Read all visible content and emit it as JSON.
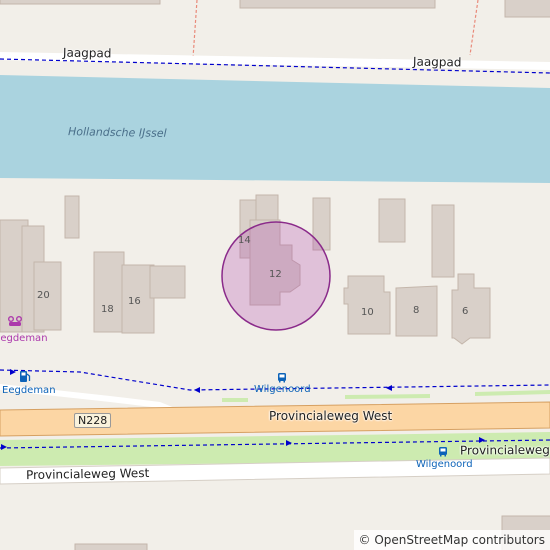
{
  "map": {
    "streets": {
      "jaagpad_left": "Jaagpad",
      "jaagpad_right": "Jaagpad",
      "provincialeweg_main": "Provincialeweg West",
      "provincialeweg_right": "Provincialeweg West",
      "provincialeweg_bottom": "Provincialeweg West",
      "road_ref": "N228"
    },
    "water": {
      "name": "Hollandsche IJssel"
    },
    "house_numbers": [
      "14",
      "12",
      "20",
      "16",
      "18",
      "10",
      "8",
      "6"
    ],
    "pois": {
      "eegdeman_top": "Eegdeman",
      "eegdeman_fuel": "Eegdeman",
      "wilgenoord_top": "Wilgenoord",
      "wilgenoord_bottom": "Wilgenoord"
    },
    "icons": {
      "car_repair": "car-repair-icon",
      "fuel": "fuel-icon",
      "bus_stop": "bus-stop-icon"
    },
    "colors": {
      "background": "#f2efe9",
      "water": "#aad3df",
      "building": "#d9d0c9",
      "primary_road": "#fcd6a4",
      "highlight": "#ac39ac",
      "path": "#0000cc",
      "grass": "#cdebb0"
    }
  },
  "attribution": "© OpenStreetMap contributors"
}
